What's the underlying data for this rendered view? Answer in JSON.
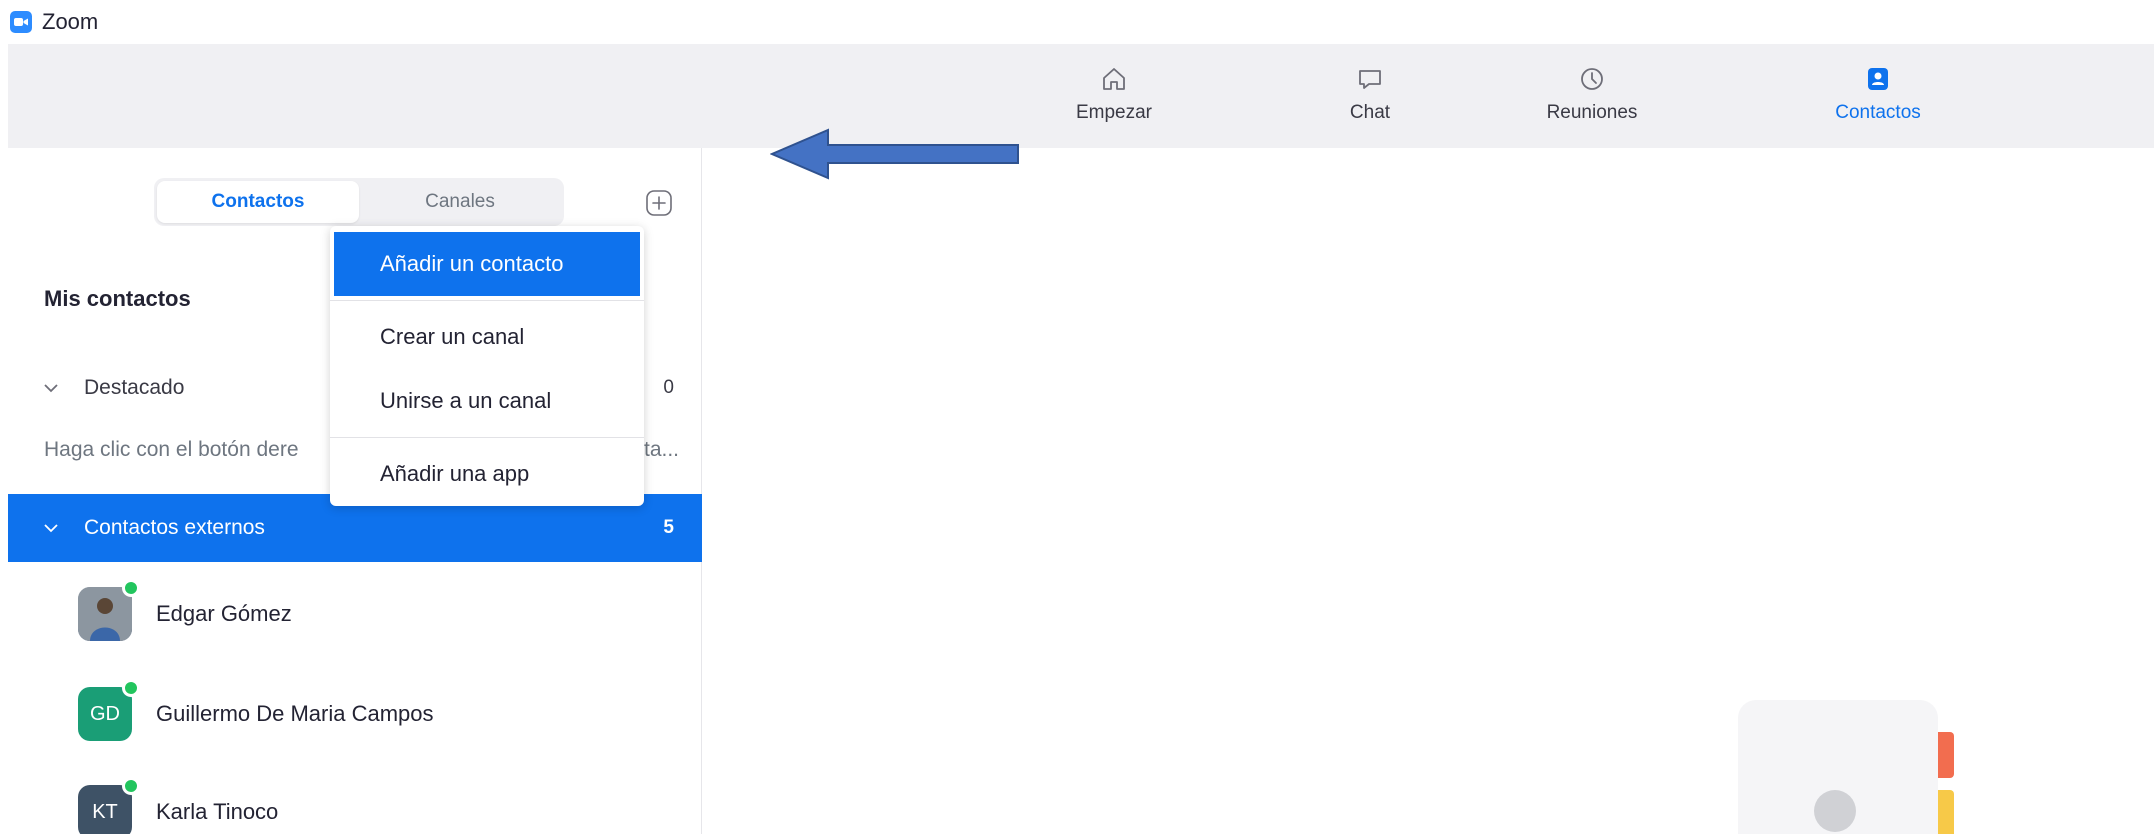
{
  "window": {
    "title": "Zoom",
    "logo_icon": "zoom-camera-icon"
  },
  "nav": {
    "items": [
      {
        "label": "Empezar",
        "icon": "home-icon"
      },
      {
        "label": "Chat",
        "icon": "chat-icon"
      },
      {
        "label": "Reuniones",
        "icon": "clock-icon"
      },
      {
        "label": "Contactos",
        "icon": "contacts-icon",
        "active": true
      }
    ]
  },
  "sidebar": {
    "tabs": [
      {
        "label": "Contactos",
        "active": true
      },
      {
        "label": "Canales",
        "active": false
      }
    ],
    "section_title": "Mis contactos",
    "starred": {
      "label": "Destacado",
      "count": "0"
    },
    "hint_text": "Haga clic con el botón dere",
    "hint_tail": "ta...",
    "external": {
      "label": "Contactos externos",
      "count": "5"
    },
    "contacts": [
      {
        "name": "Edgar Gómez",
        "initials": "",
        "avatar_color": "#5b6f86",
        "online": true
      },
      {
        "name": "Guillermo De Maria Campos",
        "initials": "GD",
        "avatar_color": "#1a9e76",
        "online": true
      },
      {
        "name": "Karla Tinoco",
        "initials": "KT",
        "avatar_color": "#3e5266",
        "online": true
      }
    ]
  },
  "menu": {
    "items": [
      {
        "label": "Añadir un contacto",
        "highlighted": true
      },
      {
        "label": "Crear un canal"
      },
      {
        "label": "Unirse a un canal"
      },
      {
        "label": "Añadir una app"
      }
    ]
  },
  "colors": {
    "accent": "#0e72ed",
    "nav_bg": "#f0f0f3",
    "online": "#22c55e",
    "arrow": "#4472c4"
  }
}
